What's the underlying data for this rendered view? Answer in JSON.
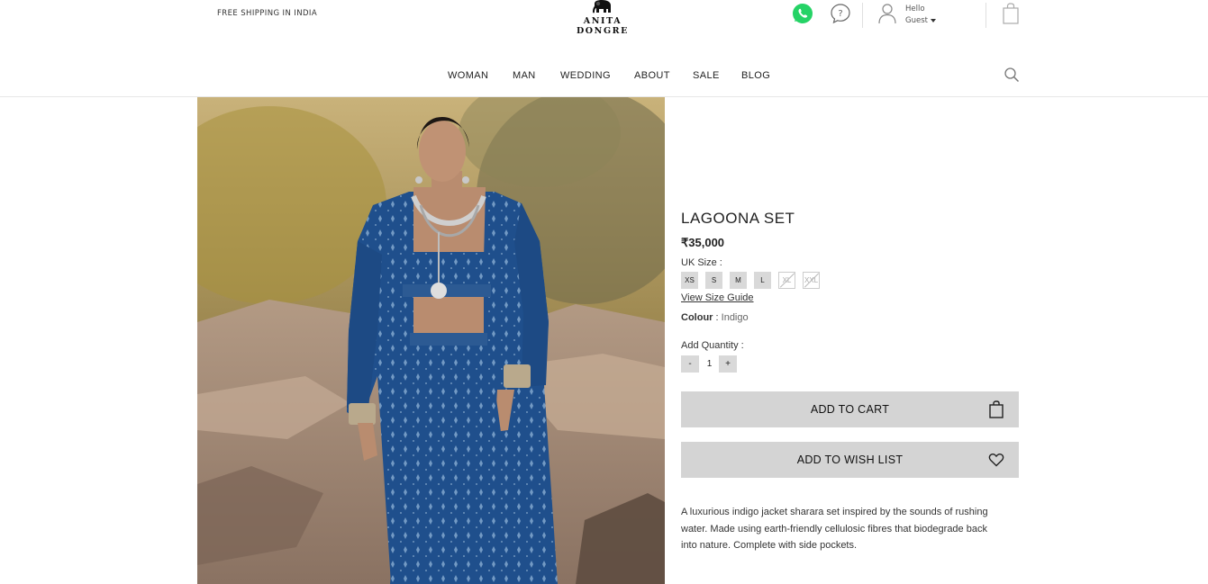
{
  "header": {
    "shipping_text": "FREE SHIPPING IN INDIA",
    "brand": "ANITA DONGRE",
    "greeting": "Hello",
    "user_name": "Guest"
  },
  "nav": {
    "items": [
      "WOMAN",
      "MAN",
      "WEDDING",
      "ABOUT",
      "SALE",
      "BLOG"
    ]
  },
  "product": {
    "title": "LAGOONA SET",
    "price": "₹35,000",
    "size_label": "UK Size :",
    "sizes": [
      {
        "label": "XS",
        "available": true
      },
      {
        "label": "S",
        "available": true
      },
      {
        "label": "M",
        "available": true
      },
      {
        "label": "L",
        "available": true
      },
      {
        "label": "XL",
        "available": false
      },
      {
        "label": "XXL",
        "available": false
      }
    ],
    "size_guide_link": "View Size Guide",
    "colour_label": "Colour",
    "colour_sep": ":",
    "colour_value": "Indigo",
    "quantity_label": "Add Quantity :",
    "quantity_minus": "-",
    "quantity_value": "1",
    "quantity_plus": "+",
    "add_to_cart_label": "ADD TO CART",
    "add_to_wishlist_label": "ADD TO WISH LIST",
    "description": "A luxurious indigo jacket sharara set inspired by the sounds of rushing water. Made using earth-friendly cellulosic fibres that biodegrade back into nature. Complete with side pockets."
  },
  "colors": {
    "whatsapp": "#25d366",
    "button_bg": "#d4d4d4",
    "size_bg": "#d9d9d9",
    "garment_indigo": "#1f4f8c"
  },
  "icons": [
    "whatsapp-icon",
    "help-icon",
    "user-icon",
    "bag-icon",
    "search-icon",
    "cart-bag-icon",
    "heart-icon",
    "elephant-logo-icon"
  ]
}
